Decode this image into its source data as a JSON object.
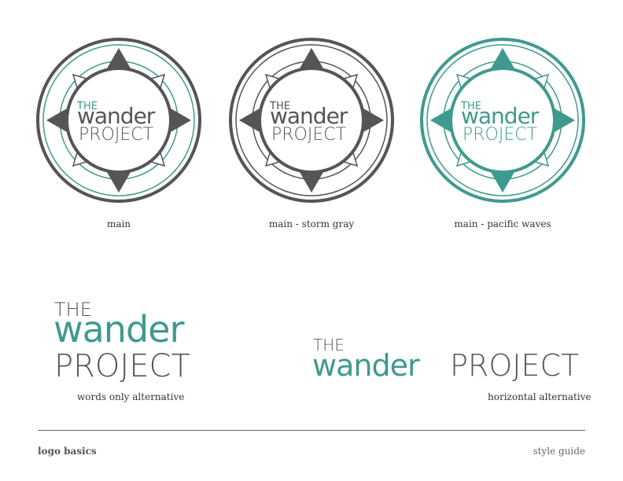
{
  "brand": {
    "line1": "THE",
    "line2": "wander",
    "line3": "PROJECT"
  },
  "colors": {
    "storm_gray": "#555555",
    "pacific_waves": "#3f9a8e",
    "text_gray": "#555555"
  },
  "badges": [
    {
      "caption": "main"
    },
    {
      "caption": "main - storm gray"
    },
    {
      "caption": "main - pacific waves"
    }
  ],
  "alternatives": {
    "words_only_caption": "words only alternative",
    "horizontal_caption": "horizontal alternative"
  },
  "footer": {
    "left": "logo basics",
    "right": "style guide"
  }
}
